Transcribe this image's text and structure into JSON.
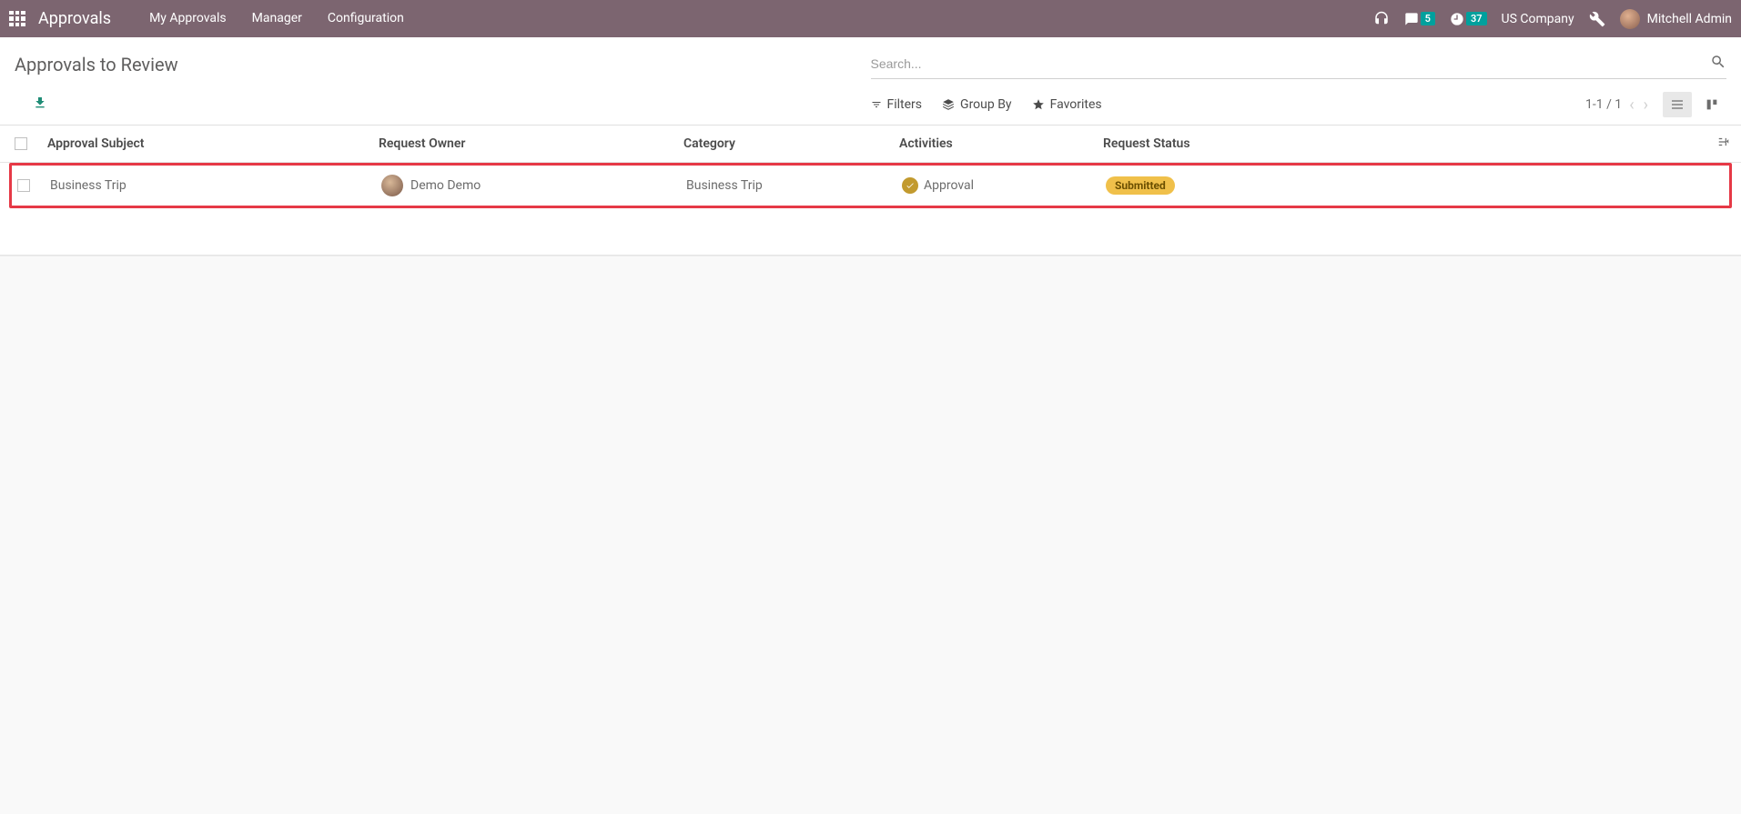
{
  "navbar": {
    "app_name": "Approvals",
    "menu": [
      "My Approvals",
      "Manager",
      "Configuration"
    ],
    "messages_badge": "5",
    "clock_badge": "37",
    "company": "US Company",
    "user": "Mitchell Admin"
  },
  "controls": {
    "page_title": "Approvals to Review",
    "search_placeholder": "Search...",
    "filters_label": "Filters",
    "groupby_label": "Group By",
    "favorites_label": "Favorites",
    "pager": "1-1 / 1"
  },
  "table": {
    "headers": {
      "subject": "Approval Subject",
      "owner": "Request Owner",
      "category": "Category",
      "activities": "Activities",
      "status": "Request Status"
    },
    "rows": [
      {
        "subject": "Business Trip",
        "owner": "Demo Demo",
        "category": "Business Trip",
        "activity": "Approval",
        "status": "Submitted"
      }
    ]
  }
}
